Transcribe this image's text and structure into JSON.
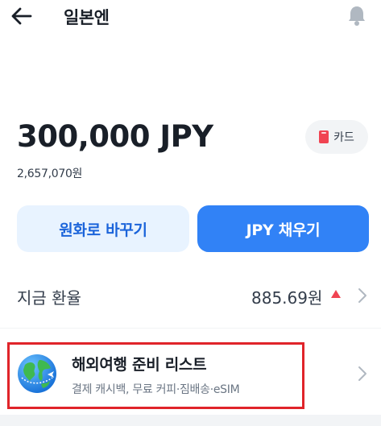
{
  "header": {
    "back_icon": "arrow-left-icon",
    "title": "일본엔",
    "notification_icon": "bell-icon"
  },
  "account": {
    "balance": "300,000 JPY",
    "balance_krw": "2,657,070원",
    "card_chip": {
      "icon": "card-icon",
      "label": "카드"
    }
  },
  "actions": {
    "convert_label": "원화로 바꾸기",
    "charge_label": "JPY 채우기"
  },
  "exchange_rate": {
    "label": "지금 환율",
    "value": "885.69원",
    "trend_icon": "triangle-up-icon",
    "chevron_icon": "chevron-right-icon"
  },
  "promo": {
    "icon": "globe-airplane-icon",
    "title": "해외여행 준비 리스트",
    "subtitle": "결제 캐시백, 무료 커피·짐배송·eSIM",
    "chevron_icon": "chevron-right-icon"
  },
  "colors": {
    "primary": "#3182f6",
    "primary_light": "#e8f3ff",
    "primary_text": "#1b64da",
    "up_red": "#f04452",
    "highlight_border": "#e0242a",
    "card_red": "#f04452"
  }
}
